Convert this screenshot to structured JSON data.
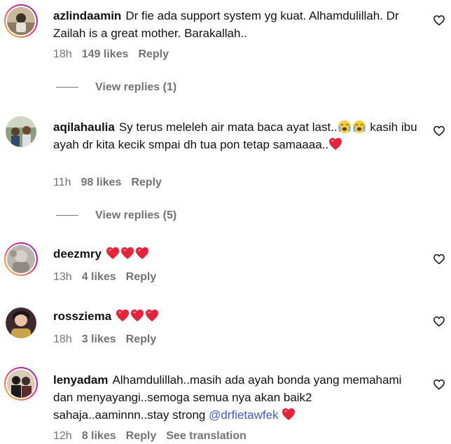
{
  "comments": [
    {
      "username": "azlindaamin",
      "text": "Dr fie ada support system yg kuat. Alhamdulillah. Dr Zailah is a great mother. Barakallah..",
      "time": "18h",
      "likes": "149 likes",
      "reply": "Reply",
      "view_replies": "View replies (1)"
    },
    {
      "username": "aqilahaulia",
      "text_before_emoji": "Sy terus meleleh air mata baca ayat last..",
      "text_after_emoji": "kasih ibu ayah dr kita kecik smpai dh tua pon tetap samaaaa..",
      "emoji_names": [
        "loudly-crying-face",
        "loudly-crying-face",
        "red-heart"
      ],
      "time": "11h",
      "likes": "98 likes",
      "reply": "Reply",
      "view_replies": "View replies (5)"
    },
    {
      "username": "deezmry",
      "emoji_names": [
        "red-heart",
        "red-heart",
        "red-heart"
      ],
      "time": "13h",
      "likes": "4 likes",
      "reply": "Reply"
    },
    {
      "username": "rossziema",
      "emoji_names": [
        "red-heart",
        "red-heart",
        "red-heart"
      ],
      "time": "18h",
      "likes": "3 likes",
      "reply": "Reply"
    },
    {
      "username": "lenyadam",
      "text": "Alhamdulillah..masih ada ayah bonda yang memahami dan menyayangi..semoga semua nya akan baik2 sahaja..aaminnn..stay strong",
      "mention": "@drfietawfek",
      "emoji_names": [
        "red-heart"
      ],
      "time": "12h",
      "likes": "8 likes",
      "reply": "Reply",
      "see_translation": "See translation"
    }
  ],
  "icons": {
    "like": "heart-outline-icon",
    "emoji_heart": "red-heart",
    "emoji_cry": "loudly-crying-face"
  },
  "colors": {
    "text": "#111111",
    "meta": "#737373",
    "mention": "#3f5ccc",
    "heart": "#e0245e",
    "story_ring_start": "#f9ce34",
    "story_ring_end": "#6228d7"
  }
}
